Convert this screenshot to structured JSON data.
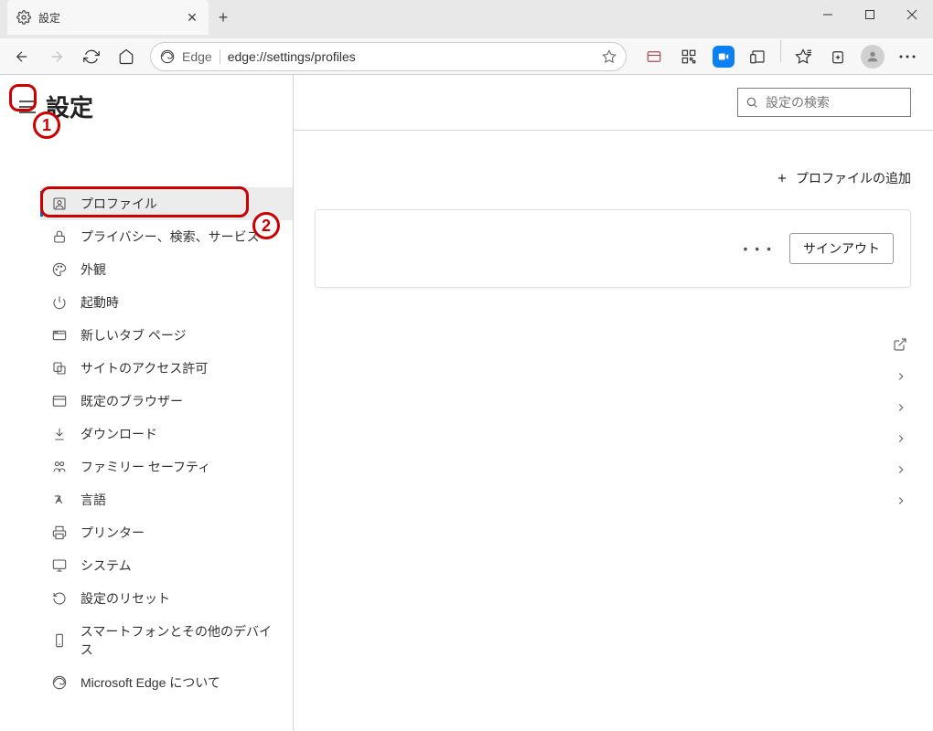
{
  "window": {
    "tab_title": "設定",
    "address_prefix": "Edge",
    "address_url": "edge://settings/profiles"
  },
  "sidebar": {
    "page_title": "設定",
    "items": [
      {
        "label": "プロファイル",
        "icon": "profile",
        "active": true
      },
      {
        "label": "プライバシー、検索、サービス",
        "icon": "lock",
        "active": false
      },
      {
        "label": "外観",
        "icon": "palette",
        "active": false
      },
      {
        "label": "起動時",
        "icon": "power",
        "active": false
      },
      {
        "label": "新しいタブ ページ",
        "icon": "tab",
        "active": false
      },
      {
        "label": "サイトのアクセス許可",
        "icon": "permissions",
        "active": false
      },
      {
        "label": "既定のブラウザー",
        "icon": "browser",
        "active": false
      },
      {
        "label": "ダウンロード",
        "icon": "download",
        "active": false
      },
      {
        "label": "ファミリー セーフティ",
        "icon": "family",
        "active": false
      },
      {
        "label": "言語",
        "icon": "language",
        "active": false
      },
      {
        "label": "プリンター",
        "icon": "printer",
        "active": false
      },
      {
        "label": "システム",
        "icon": "system",
        "active": false
      },
      {
        "label": "設定のリセット",
        "icon": "reset",
        "active": false
      },
      {
        "label": "スマートフォンとその他のデバイス",
        "icon": "phone",
        "active": false
      },
      {
        "label": "Microsoft Edge について",
        "icon": "edge",
        "active": false
      }
    ]
  },
  "main": {
    "search_placeholder": "設定の検索",
    "add_profile_label": "プロファイルの追加",
    "signout_label": "サインアウト"
  },
  "annotations": {
    "callout1_label": "1",
    "callout2_label": "2"
  }
}
